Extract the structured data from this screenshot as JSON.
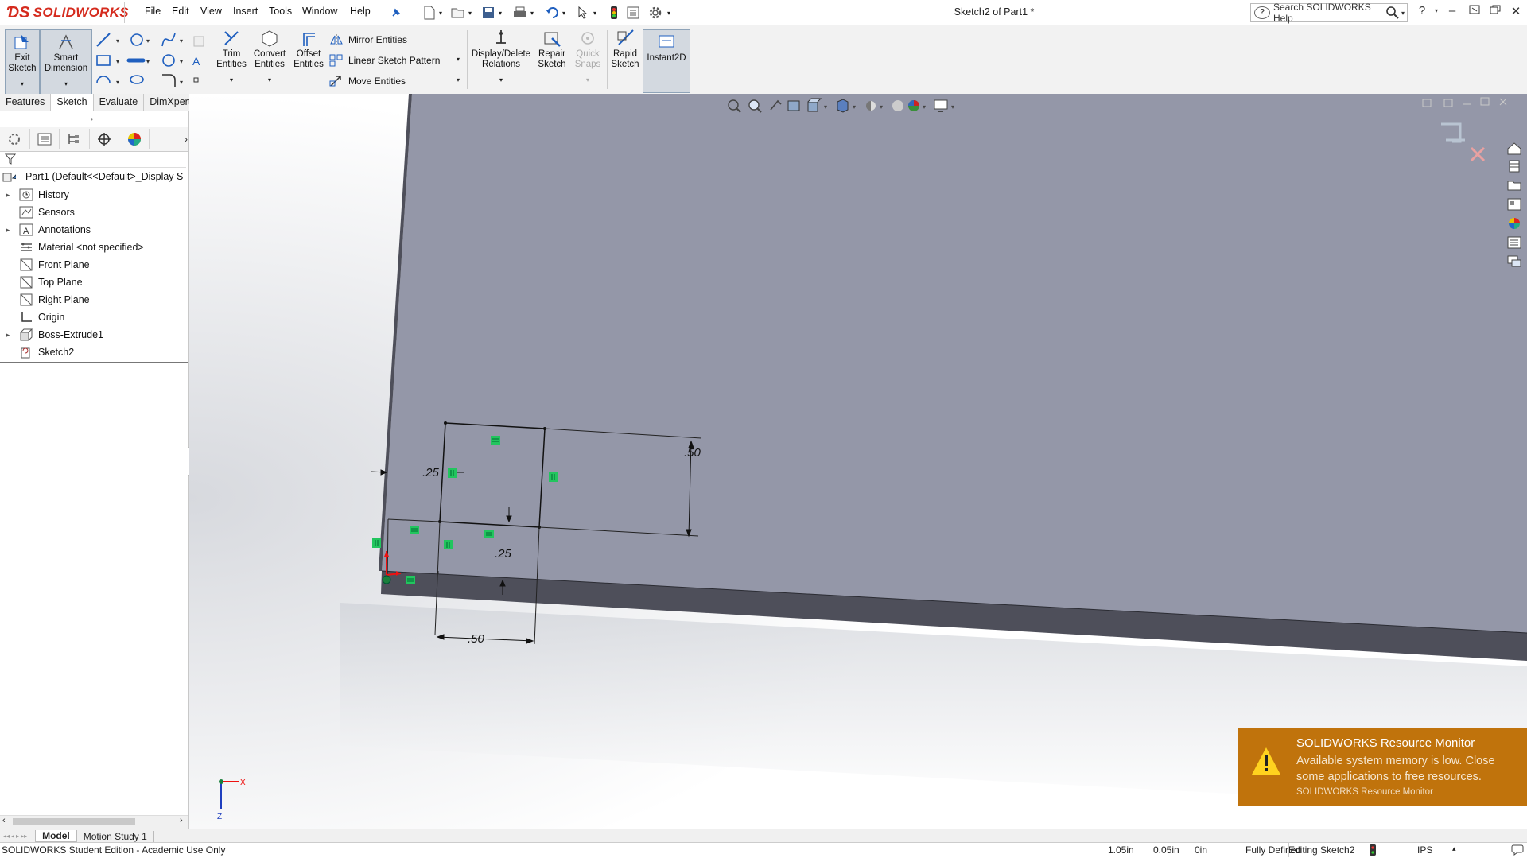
{
  "app": {
    "logo_text": "SOLIDWORKS",
    "document_title": "Sketch2 of Part1 *",
    "search_placeholder": "Search SOLIDWORKS Help"
  },
  "menu": [
    "File",
    "Edit",
    "View",
    "Insert",
    "Tools",
    "Window",
    "Help"
  ],
  "ribbon": {
    "exit_sketch": "Exit\nSketch",
    "exit_sketch_l1": "Exit",
    "exit_sketch_l2": "Sketch",
    "smart_dim_l1": "Smart",
    "smart_dim_l2": "Dimension",
    "trim_l1": "Trim",
    "trim_l2": "Entities",
    "convert_l1": "Convert",
    "convert_l2": "Entities",
    "offset_l1": "Offset",
    "offset_l2": "Entities",
    "mirror": "Mirror Entities",
    "linear_pattern": "Linear Sketch Pattern",
    "move": "Move Entities",
    "display_relations_l1": "Display/Delete",
    "display_relations_l2": "Relations",
    "repair_l1": "Repair",
    "repair_l2": "Sketch",
    "quick_snaps_l1": "Quick",
    "quick_snaps_l2": "Snaps",
    "rapid_l1": "Rapid",
    "rapid_l2": "Sketch",
    "instant2d": "Instant2D"
  },
  "tabs": [
    "Features",
    "Sketch",
    "Evaluate",
    "DimXpert"
  ],
  "tree": {
    "root": "Part1  (Default<<Default>_Display S",
    "items": [
      {
        "label": "History",
        "expandable": true
      },
      {
        "label": "Sensors",
        "expandable": false
      },
      {
        "label": "Annotations",
        "expandable": true
      },
      {
        "label": "Material <not specified>",
        "expandable": false
      },
      {
        "label": "Front Plane",
        "expandable": false
      },
      {
        "label": "Top Plane",
        "expandable": false
      },
      {
        "label": "Right Plane",
        "expandable": false
      },
      {
        "label": "Origin",
        "expandable": false
      },
      {
        "label": "Boss-Extrude1",
        "expandable": true
      },
      {
        "label": "Sketch2",
        "expandable": false
      }
    ]
  },
  "sketch": {
    "dim_top_right": ".50",
    "dim_left": ".25",
    "dim_bottom_small": ".25",
    "dim_bottom": ".50"
  },
  "triad": {
    "x": "X",
    "z": "Z"
  },
  "notification": {
    "title": "SOLIDWORKS Resource Monitor",
    "message": "Available system memory is low. Close some applications to free resources.",
    "source": "SOLIDWORKS Resource Monitor"
  },
  "bottom_tabs": [
    "Model",
    "Motion Study 1"
  ],
  "status": {
    "edition": "SOLIDWORKS Student Edition - Academic Use Only",
    "x": "1.05in",
    "y": "0.05in",
    "z": "0in",
    "state": "Fully Defined",
    "editing": "Editing Sketch2",
    "units": "IPS"
  },
  "colors": {
    "brand": "#d52b1e",
    "face": "#9497a8",
    "face_edge": "#4e4f5a",
    "relation_marker": "#22c55e",
    "notify_bg": "#c0730c"
  }
}
